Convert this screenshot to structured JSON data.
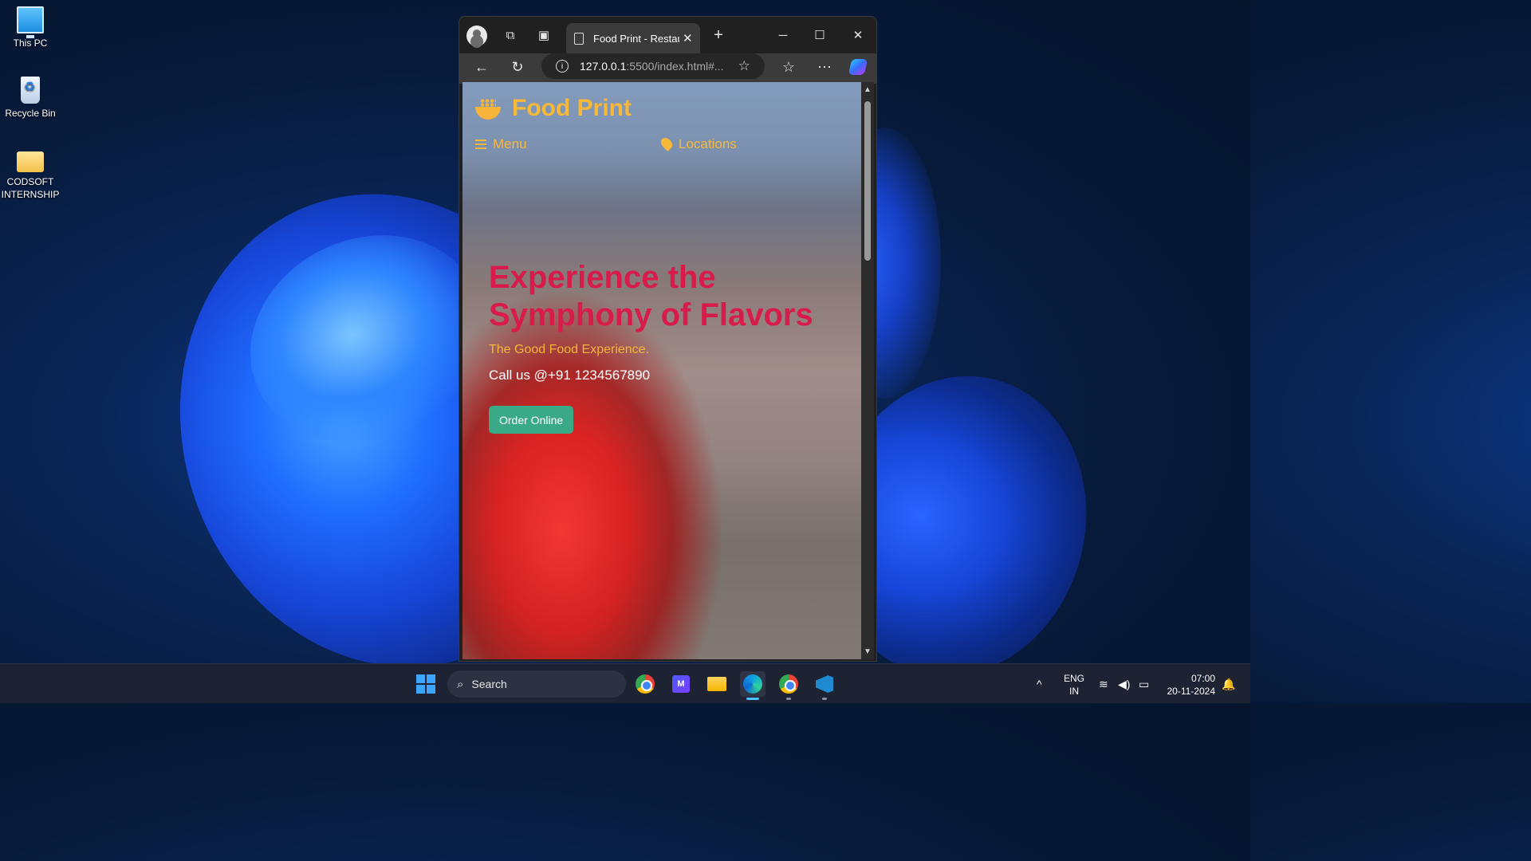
{
  "desktop": {
    "icons": [
      {
        "label": "This PC"
      },
      {
        "label": "Recycle Bin"
      },
      {
        "label": "CODSOFT INTERNSHIP"
      }
    ]
  },
  "browser": {
    "tab_title": "Food Print - Restaurant",
    "url_host": "127.0.0.1",
    "url_path": ":5500/index.html#...",
    "window_controls": {
      "minimize": "─",
      "maximize": "☐",
      "close": "✕"
    }
  },
  "site": {
    "brand": "Food Print",
    "nav": {
      "menu": "Menu",
      "locations": "Locations"
    },
    "hero": {
      "title": "Experience the Symphony of Flavors",
      "tagline": "The Good Food Experience.",
      "phone": "Call us @+91 1234567890",
      "cta": "Order Online"
    },
    "colors": {
      "brand": "#f8b838",
      "title": "#d81b4a",
      "cta": "#3aa985"
    }
  },
  "taskbar": {
    "search_label": "Search",
    "language": "ENG",
    "region": "IN",
    "time": "07:00",
    "date": "20-11-2024"
  }
}
